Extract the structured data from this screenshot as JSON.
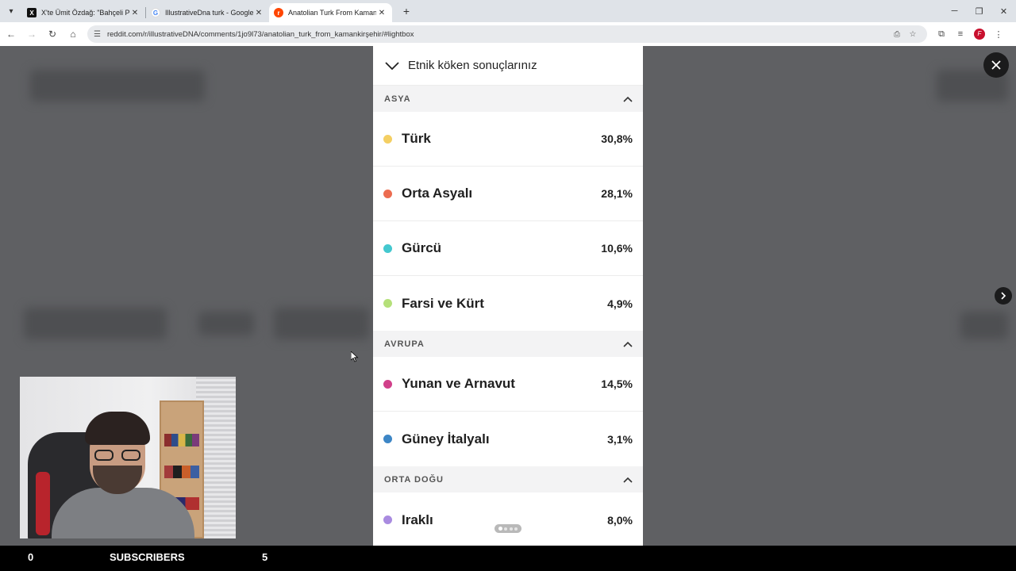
{
  "browser": {
    "tabs": [
      {
        "favicon": "x-logo-icon",
        "title": "X'te Ümit Özdağ: \"Bahçeli PKK'y",
        "active": false
      },
      {
        "favicon": "google-logo-icon",
        "title": "IllustrativeDna turk - Google'da",
        "active": false
      },
      {
        "favicon": "reddit-logo-icon",
        "title": "Anatolian Turk From Kaman/Kır",
        "active": true
      }
    ],
    "url": "reddit.com/r/illustrativeDNA/comments/1jo9l73/anatolian_turk_from_kamankirşehir/#lightbox"
  },
  "panel": {
    "title": "Etnik köken sonuçlarınız",
    "sections": [
      {
        "name": "ASYA",
        "items": [
          {
            "label": "Türk",
            "pct": "30,8%",
            "color": "#f4cf63"
          },
          {
            "label": "Orta Asyalı",
            "pct": "28,1%",
            "color": "#ec6c50"
          },
          {
            "label": "Gürcü",
            "pct": "10,6%",
            "color": "#44c8cf"
          },
          {
            "label": "Farsi ve Kürt",
            "pct": "4,9%",
            "color": "#b5e07a"
          }
        ]
      },
      {
        "name": "AVRUPA",
        "items": [
          {
            "label": "Yunan ve Arnavut",
            "pct": "14,5%",
            "color": "#d1408a"
          },
          {
            "label": "Güney İtalyalı",
            "pct": "3,1%",
            "color": "#3d86c6"
          }
        ]
      },
      {
        "name": "ORTA DOĞU",
        "items": [
          {
            "label": "Iraklı",
            "pct": "8,0%",
            "color": "#a98be0"
          }
        ]
      }
    ]
  },
  "stream_bar": {
    "left_count": "0",
    "label": "SUBSCRIBERS",
    "right_count": "5"
  }
}
